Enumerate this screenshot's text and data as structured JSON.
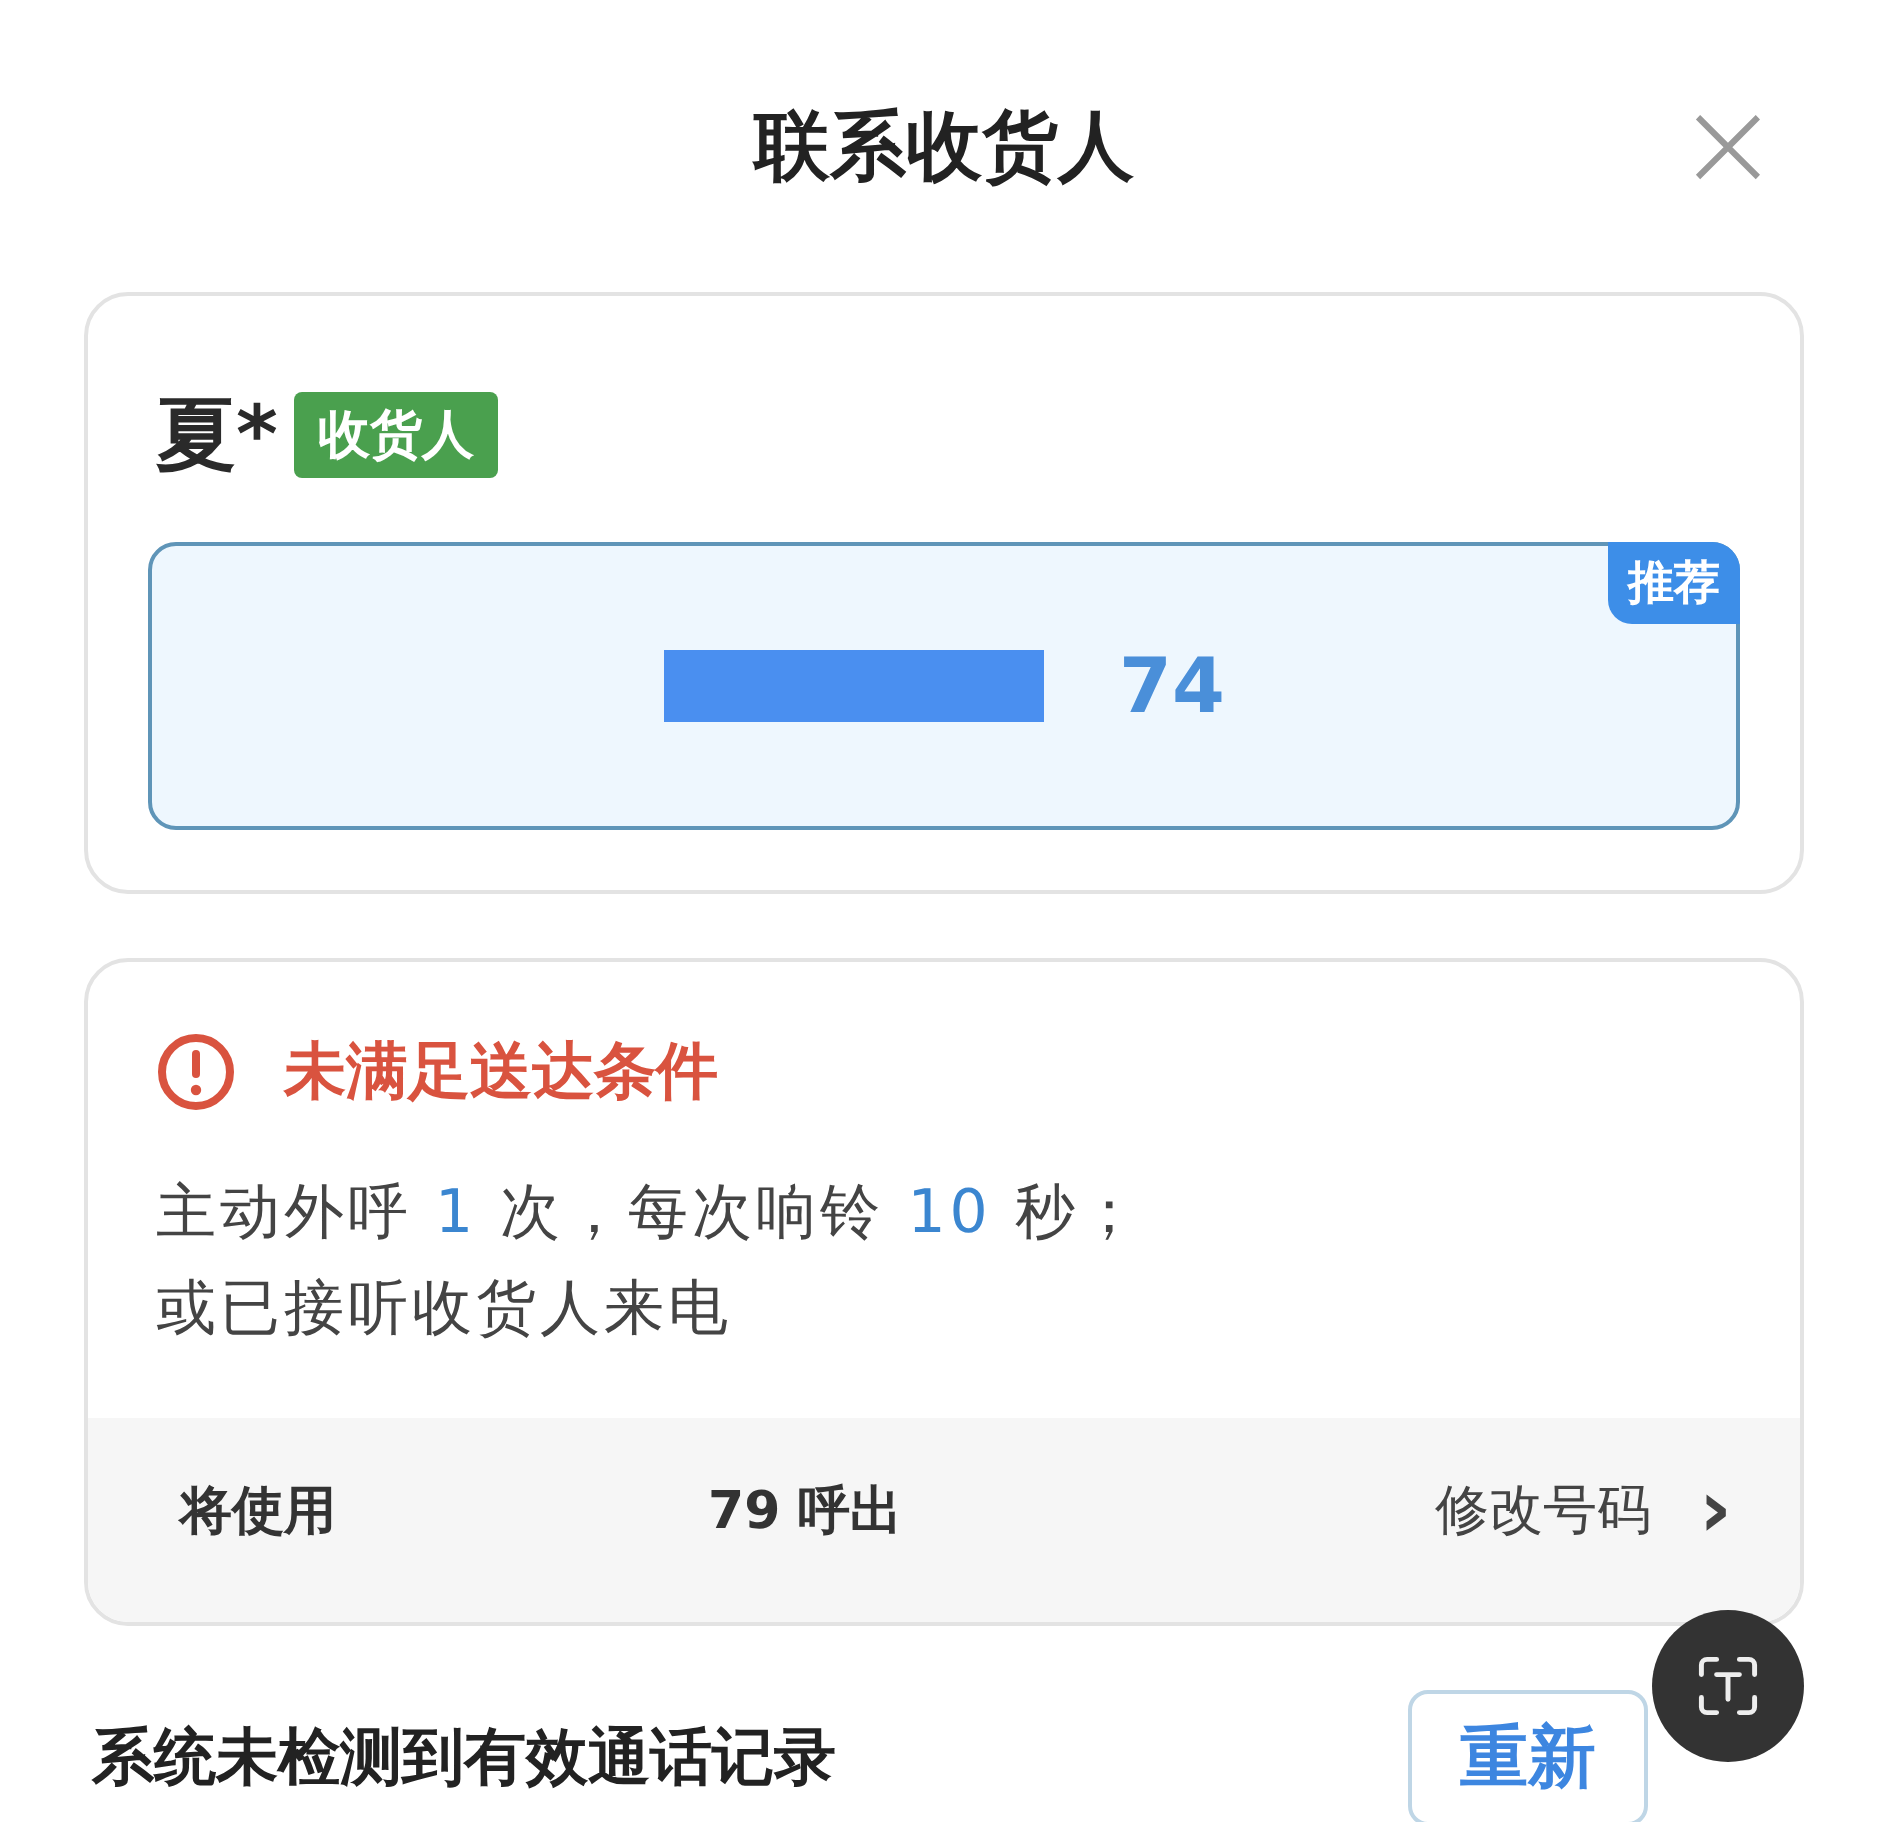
{
  "dialog": {
    "title": "联系收货人",
    "close": "×"
  },
  "contact": {
    "name": "夏*",
    "tag": "收货人",
    "phone_visible": "74",
    "badge": "推荐",
    "recommended": true
  },
  "status": {
    "title": "未满足送达条件",
    "lines": [
      [
        "主动外呼 ",
        "1",
        " 次，每次响铃 ",
        "10",
        " 秒；"
      ],
      [
        "或已接听收货人来电"
      ]
    ],
    "caller_prefix": "将使用",
    "caller_suffix": "79 呼出",
    "change_link": "修改号码",
    "chevron": "›"
  },
  "footer": {
    "message": "系统未检测到有效通话记录",
    "button": "重新"
  }
}
